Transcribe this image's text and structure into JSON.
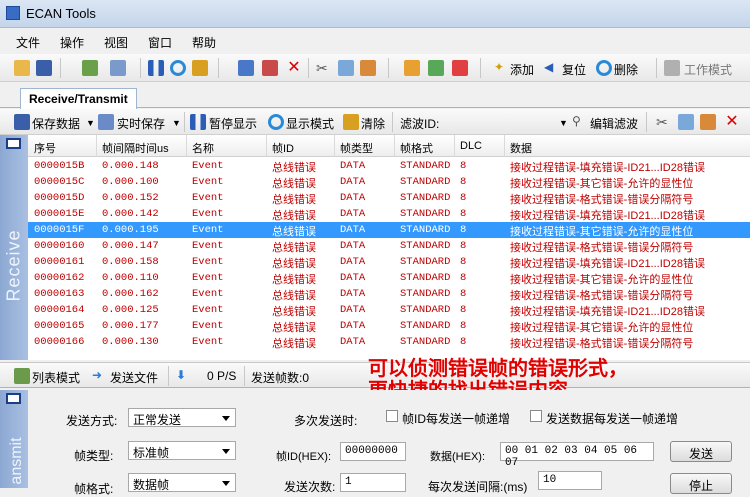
{
  "window": {
    "title": "ECAN Tools"
  },
  "menu": [
    "文件",
    "操作",
    "视图",
    "窗口",
    "帮助"
  ],
  "toolbar": {
    "add": "添加",
    "reset": "复位",
    "delete": "删除",
    "work_mode": "工作模式"
  },
  "tab": {
    "label": "Receive/Transmit"
  },
  "receive_toolbar": {
    "save_data": "保存数据",
    "realtime_save": "实时保存",
    "pause_display": "暂停显示",
    "display_mode": "显示模式",
    "clear": "清除",
    "filter_id": "滤波ID:",
    "edit_filter": "编辑滤波"
  },
  "sidebar": {
    "receive": "Receive",
    "transmit": "ansmit"
  },
  "table": {
    "headers": [
      "序号",
      "帧间隔时间us",
      "名称",
      "帧ID",
      "帧类型",
      "帧格式",
      "DLC",
      "数据"
    ],
    "rows": [
      [
        "0000015B",
        "0.000.148",
        "Event",
        "总线错误",
        "DATA",
        "STANDARD",
        "8",
        "接收过程错误-填充错误-ID21...ID28错误"
      ],
      [
        "0000015C",
        "0.000.100",
        "Event",
        "总线错误",
        "DATA",
        "STANDARD",
        "8",
        "接收过程错误-其它错误-允许的显性位"
      ],
      [
        "0000015D",
        "0.000.152",
        "Event",
        "总线错误",
        "DATA",
        "STANDARD",
        "8",
        "接收过程错误-格式错误-错误分隔符号"
      ],
      [
        "0000015E",
        "0.000.142",
        "Event",
        "总线错误",
        "DATA",
        "STANDARD",
        "8",
        "接收过程错误-填充错误-ID21...ID28错误"
      ],
      [
        "0000015F",
        "0.000.195",
        "Event",
        "总线错误",
        "DATA",
        "STANDARD",
        "8",
        "接收过程错误-其它错误-允许的显性位"
      ],
      [
        "00000160",
        "0.000.147",
        "Event",
        "总线错误",
        "DATA",
        "STANDARD",
        "8",
        "接收过程错误-格式错误-错误分隔符号"
      ],
      [
        "00000161",
        "0.000.158",
        "Event",
        "总线错误",
        "DATA",
        "STANDARD",
        "8",
        "接收过程错误-填充错误-ID21...ID28错误"
      ],
      [
        "00000162",
        "0.000.110",
        "Event",
        "总线错误",
        "DATA",
        "STANDARD",
        "8",
        "接收过程错误-其它错误-允许的显性位"
      ],
      [
        "00000163",
        "0.000.162",
        "Event",
        "总线错误",
        "DATA",
        "STANDARD",
        "8",
        "接收过程错误-格式错误-错误分隔符号"
      ],
      [
        "00000164",
        "0.000.125",
        "Event",
        "总线错误",
        "DATA",
        "STANDARD",
        "8",
        "接收过程错误-填充错误-ID21...ID28错误"
      ],
      [
        "00000165",
        "0.000.177",
        "Event",
        "总线错误",
        "DATA",
        "STANDARD",
        "8",
        "接收过程错误-其它错误-允许的显性位"
      ],
      [
        "00000166",
        "0.000.130",
        "Event",
        "总线错误",
        "DATA",
        "STANDARD",
        "8",
        "接收过程错误-格式错误-错误分隔符号"
      ]
    ],
    "selected_row": "0000015F"
  },
  "status": {
    "list_mode": "列表模式",
    "send_file": "发送文件",
    "rate": "0 P/S",
    "send_count": "发送帧数:0"
  },
  "annotation": {
    "line1": "可以侦测错误帧的错误形式，",
    "line2": "更快捷的找出错误内容"
  },
  "send": {
    "send_mode_label": "发送方式:",
    "send_mode_value": "正常发送",
    "multi_send_label": "多次发送时:",
    "inc_id_label": "帧ID每发送一帧递增",
    "inc_data_label": "发送数据每发送一帧递增",
    "frame_type_label": "帧类型:",
    "frame_type_value": "标准帧",
    "frame_id_label": "帧ID(HEX):",
    "frame_id_value": "00000000",
    "data_label": "数据(HEX):",
    "data_value": "00 01 02 03 04 05 06 07",
    "send_button": "发送",
    "frame_format_label": "帧格式:",
    "frame_format_value": "数据帧",
    "send_count_label": "发送次数:",
    "send_count_value": "1",
    "interval_label": "每次发送间隔:(ms)",
    "interval_value": "10",
    "stop_button": "停止"
  },
  "colors": {
    "error_text": "#c00000",
    "selection": "#3399ff",
    "sidebar": "#8ca8d2",
    "annotation": "#e00000"
  }
}
